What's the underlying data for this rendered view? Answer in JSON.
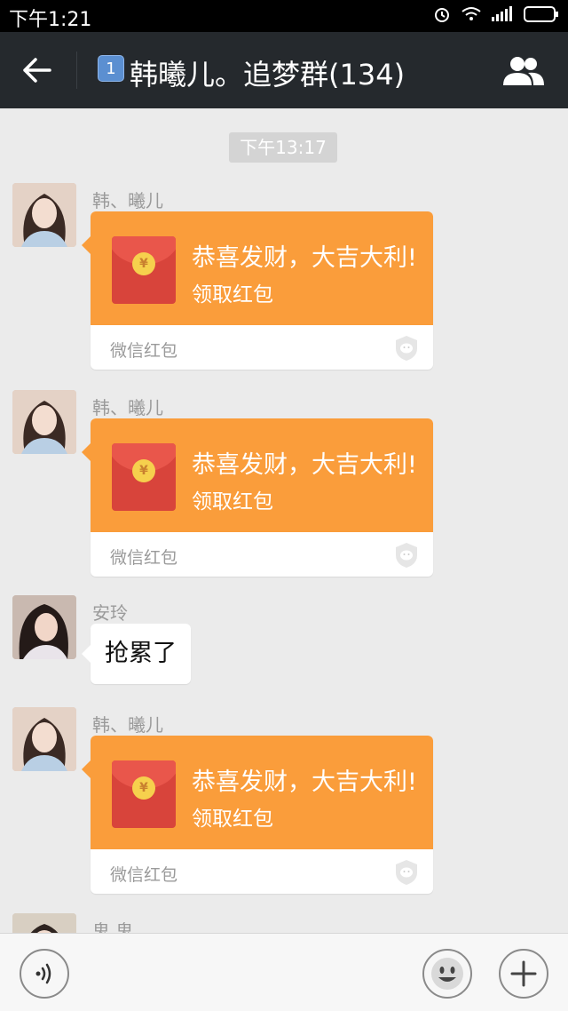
{
  "status_bar": {
    "time": "下午1:21"
  },
  "header": {
    "unread_count": "1",
    "title": "韩曦儿。追梦群(134)"
  },
  "chat": {
    "timestamp": "下午13:17",
    "messages": [
      {
        "sender": "韩、曦儿",
        "type": "red-packet",
        "greeting": "恭喜发财，大吉大利!",
        "action": "领取红包",
        "footer": "微信红包"
      },
      {
        "sender": "韩、曦儿",
        "type": "red-packet",
        "greeting": "恭喜发财，大吉大利!",
        "action": "领取红包",
        "footer": "微信红包"
      },
      {
        "sender": "安玲",
        "type": "text",
        "text": "抢累了"
      },
      {
        "sender": "韩、曦儿",
        "type": "red-packet",
        "greeting": "恭喜发财，大吉大利!",
        "action": "领取红包",
        "footer": "微信红包"
      },
      {
        "sender": "鬼 鬼",
        "type": "partial"
      }
    ],
    "coin_symbol": "¥"
  },
  "icons": {
    "back": "arrow-left-icon",
    "members": "group-icon",
    "voice": "voice-icon",
    "emoji": "smiley-icon",
    "more": "plus-icon"
  },
  "colors": {
    "packet": "#fa9d3b",
    "header": "#25292d",
    "background": "#ebebeb"
  }
}
